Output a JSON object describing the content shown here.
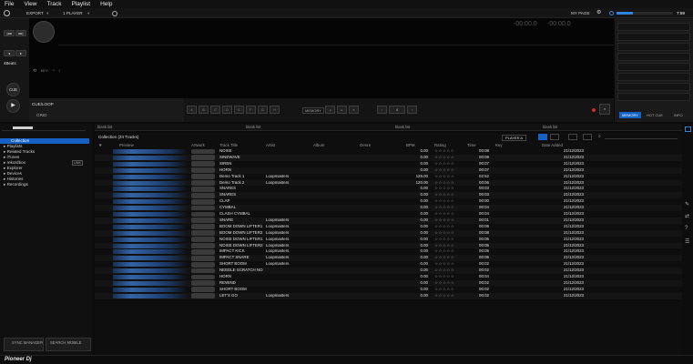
{
  "menu": [
    "File",
    "View",
    "Track",
    "Playlist",
    "Help"
  ],
  "toolbar": {
    "mode": "EXPORT",
    "player": "1 PLAYER",
    "my_page": "MY PAGE",
    "time": "7:59"
  },
  "left": {
    "beats": "4Beats",
    "cue": "CUE"
  },
  "deck": {
    "time_elapsed": "-00:00.0",
    "time_remain": "-00:00.0",
    "cue_loop": "CUE/LOOP",
    "grid": "GRID",
    "memory": "MEMORY",
    "pad_labels": [
      "A",
      "B",
      "C",
      "D",
      "E",
      "F",
      "G",
      "H"
    ],
    "beat_value": "4"
  },
  "sampler": {
    "tabs": [
      "MEMORY",
      "HOT CUE",
      "INFO"
    ]
  },
  "tree": {
    "items": [
      "Collection",
      "Playlists",
      "Related Tracks",
      "iTunes",
      "rekordbox",
      "Explorer",
      "Devices",
      "Histories",
      "Recordings"
    ],
    "sync_manager": "SYNC MANAGER",
    "search_mobile": "SEARCH MOBILE",
    "link_badge": "LINK"
  },
  "browser": {
    "panel_labels": [
      "blank list",
      "blank list",
      "blank list",
      "blank list"
    ],
    "collection_title": "Collection (24 Tracks)",
    "player_select": "PLAYER A",
    "columns": [
      "Preview",
      "Artwork",
      "Track Title",
      "Artist",
      "Album",
      "Genre",
      "BPM",
      "Rating",
      "Time",
      "Key",
      "Date Added"
    ],
    "rows": [
      {
        "title": "NOISE",
        "artist": "",
        "bpm": "0.00",
        "time": "00:08",
        "date": "21/12/2023"
      },
      {
        "title": "SINEWAVE",
        "artist": "",
        "bpm": "0.00",
        "time": "00:09",
        "date": "21/12/2023"
      },
      {
        "title": "SIREN",
        "artist": "",
        "bpm": "0.00",
        "time": "00:07",
        "date": "21/12/2023"
      },
      {
        "title": "HORN",
        "artist": "",
        "bpm": "0.00",
        "time": "00:07",
        "date": "21/12/2023"
      },
      {
        "title": "Demo Track 1",
        "artist": "Loopmasters",
        "bpm": "128.00",
        "time": "02:52",
        "date": "21/12/2023"
      },
      {
        "title": "Demo Track 2",
        "artist": "Loopmasters",
        "bpm": "120.00",
        "time": "00:06",
        "date": "21/12/2023"
      },
      {
        "title": "SNARES",
        "artist": "",
        "bpm": "0.00",
        "time": "00:03",
        "date": "21/12/2023"
      },
      {
        "title": "SNARES",
        "artist": "",
        "bpm": "0.00",
        "time": "00:03",
        "date": "21/12/2023"
      },
      {
        "title": "CLAP",
        "artist": "",
        "bpm": "0.00",
        "time": "00:00",
        "date": "21/12/2023"
      },
      {
        "title": "CYMBAL",
        "artist": "",
        "bpm": "0.00",
        "time": "00:04",
        "date": "21/12/2023"
      },
      {
        "title": "CLASH CYMBAL",
        "artist": "",
        "bpm": "0.00",
        "time": "00:04",
        "date": "21/12/2023"
      },
      {
        "title": "SNARE",
        "artist": "Loopmasters",
        "bpm": "0.00",
        "time": "00:01",
        "date": "21/12/2023"
      },
      {
        "title": "BOOM DOWN LIFTER1",
        "artist": "Loopmasters",
        "bpm": "0.00",
        "time": "00:06",
        "date": "21/12/2023"
      },
      {
        "title": "BOOM DOWN LIFTER2",
        "artist": "Loopmasters",
        "bpm": "0.00",
        "time": "00:08",
        "date": "21/12/2023"
      },
      {
        "title": "NOISE DOWN LIFTER1",
        "artist": "Loopmasters",
        "bpm": "0.00",
        "time": "00:05",
        "date": "21/12/2023"
      },
      {
        "title": "NOISE DOWN LIFTER2",
        "artist": "Loopmasters",
        "bpm": "0.00",
        "time": "00:05",
        "date": "21/12/2023"
      },
      {
        "title": "IMPACT KICK",
        "artist": "Loopmasters",
        "bpm": "0.00",
        "time": "00:05",
        "date": "21/12/2023"
      },
      {
        "title": "IMPACT SNARE",
        "artist": "Loopmasters",
        "bpm": "0.00",
        "time": "00:06",
        "date": "21/12/2023"
      },
      {
        "title": "SHORT BOOM",
        "artist": "Loopmasters",
        "bpm": "0.00",
        "time": "00:02",
        "date": "21/12/2023"
      },
      {
        "title": "NEEDLE SCRATCH NO",
        "artist": "",
        "bpm": "0.00",
        "time": "00:02",
        "date": "21/12/2023"
      },
      {
        "title": "HORN",
        "artist": "",
        "bpm": "0.00",
        "time": "00:04",
        "date": "21/12/2023"
      },
      {
        "title": "REWIND",
        "artist": "",
        "bpm": "0.00",
        "time": "00:02",
        "date": "21/12/2023"
      },
      {
        "title": "SHORT BOOM",
        "artist": "",
        "bpm": "0.00",
        "time": "00:02",
        "date": "21/12/2023"
      },
      {
        "title": "LET'S GO",
        "artist": "Loopmasters",
        "bpm": "0.00",
        "time": "00:02",
        "date": "21/12/2023"
      }
    ]
  },
  "brand": "Pioneer Dj",
  "colors": {
    "accent": "#1e6fd9",
    "selected": "#1561c4",
    "star": "#9a9a9a"
  }
}
